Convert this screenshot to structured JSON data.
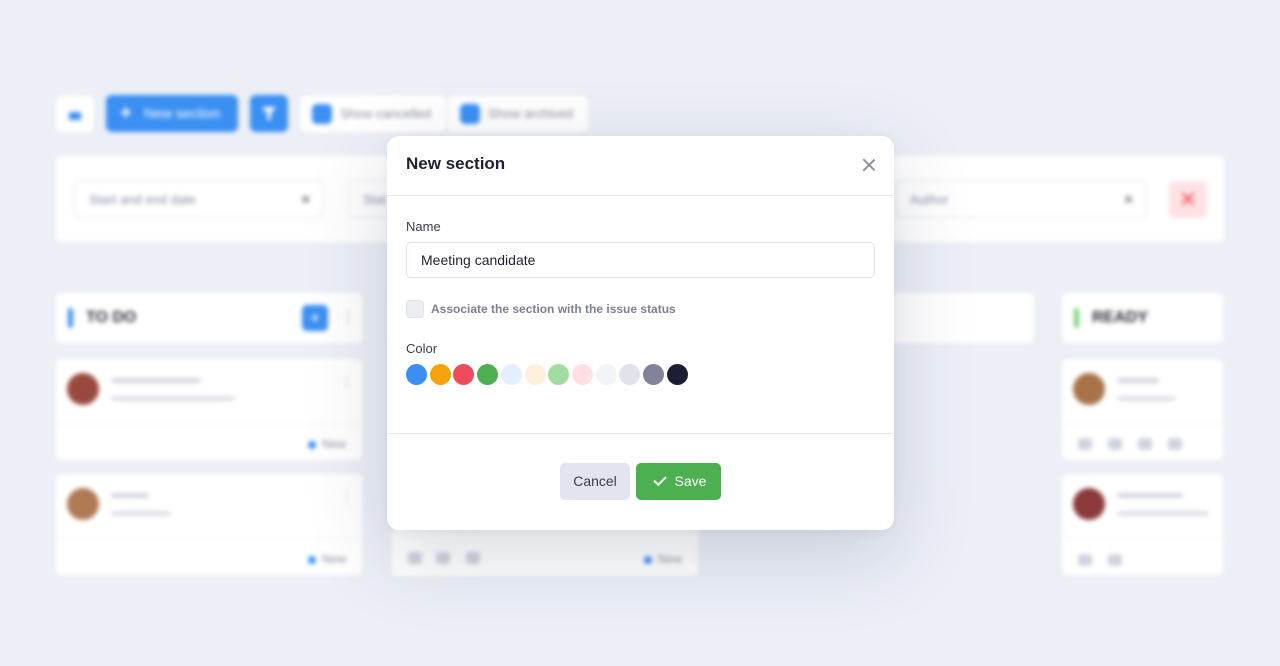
{
  "background": {
    "toolbar": {
      "new_section_label": "New section",
      "show_cancelled_label": "Show cancelled",
      "show_archived_label": "Show archived"
    },
    "filters": {
      "date_placeholder": "Start and end date",
      "status_placeholder": "Stat",
      "author_placeholder": "Author"
    },
    "columns": [
      {
        "title": "TO DO",
        "accent": "#3b8ff3"
      },
      {
        "title": "READY",
        "accent": "#7ed37e"
      }
    ],
    "card_status": "New"
  },
  "modal": {
    "title": "New section",
    "name_label": "Name",
    "name_value": "Meeting candidate",
    "associate_label": "Associate the section with the issue status",
    "associate_checked": false,
    "color_label": "Color",
    "colors": [
      "#3b8ff3",
      "#f5a30a",
      "#f04b5a",
      "#4caf50",
      "#e3efff",
      "#fff0dc",
      "#a3dca0",
      "#ffdfe4",
      "#f2f4f8",
      "#e0e3eb",
      "#80839a",
      "#1c1e33"
    ],
    "cancel_label": "Cancel",
    "save_label": "Save"
  }
}
